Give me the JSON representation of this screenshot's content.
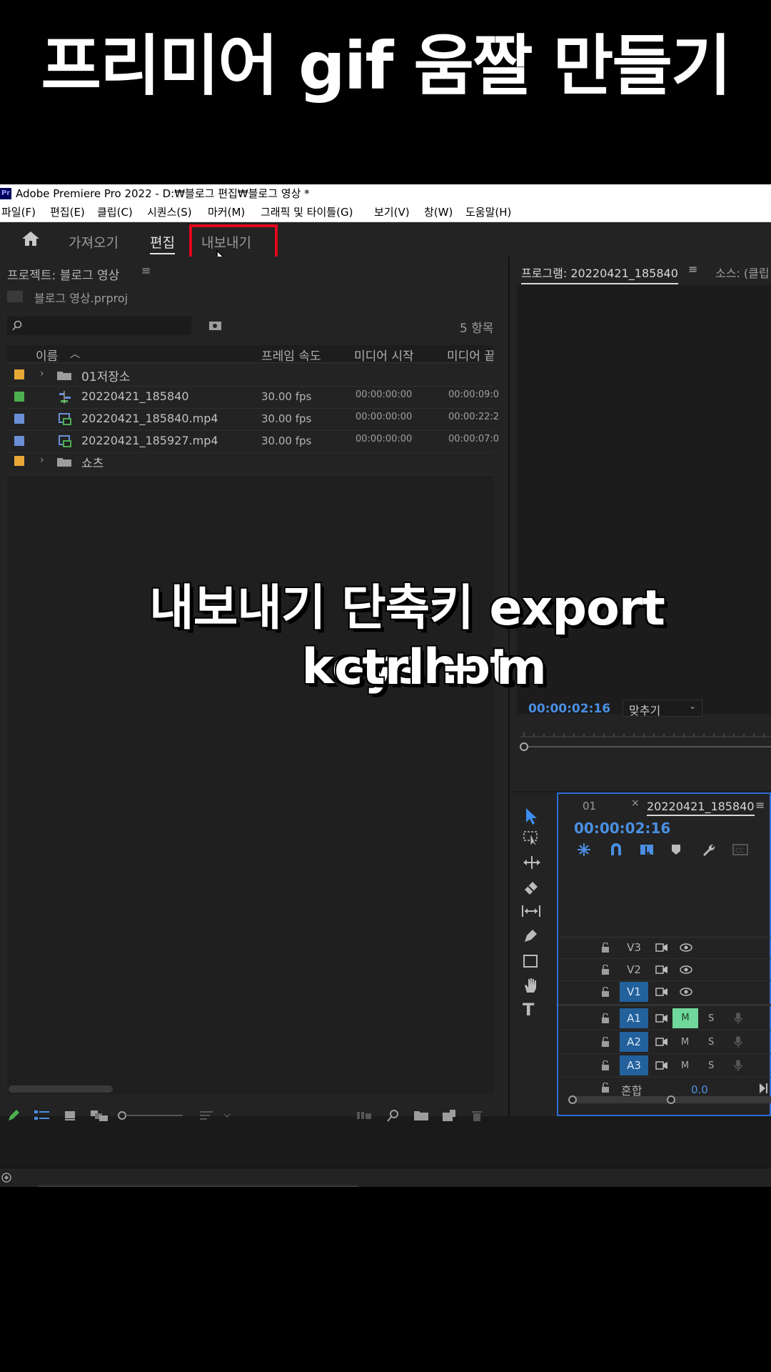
{
  "overlay_title": "프리미어 gif 움짤 만들기",
  "window": {
    "logo": "Pr",
    "title": "Adobe Premiere Pro 2022 - D:₩블로그 편집₩블로그 영상 *"
  },
  "menu": [
    "파일(F)",
    "편집(E)",
    "클립(C)",
    "시퀀스(S)",
    "마커(M)",
    "그래픽 및 타이틀(G)",
    "보기(V)",
    "창(W)",
    "도움말(H)"
  ],
  "workspace_tabs": {
    "import": "가져오기",
    "edit": "편집",
    "export": "내보내기"
  },
  "project_panel": {
    "title": "프로젝트: 블로그 영상",
    "file": "블로그 영상.prproj",
    "item_count": "5 항목",
    "columns": {
      "name": "이름",
      "fps": "프레임 속도",
      "media_start": "미디어 시작",
      "media_end": "미디어 끝"
    },
    "rows": [
      {
        "name": "01저장소",
        "fps": "",
        "start": "",
        "end": "",
        "type": "folder",
        "color": "#e8a838"
      },
      {
        "name": "20220421_185840",
        "fps": "30.00 fps",
        "start": "00:00:00:00",
        "end": "00:00:09:0",
        "type": "sequence",
        "color": "#4caf50"
      },
      {
        "name": "20220421_185840.mp4",
        "fps": "30.00 fps",
        "start": "00:00:00:00",
        "end": "00:00:22:2",
        "type": "clip",
        "color": "#6b8fd6"
      },
      {
        "name": "20220421_185927.mp4",
        "fps": "30.00 fps",
        "start": "00:00:00:00",
        "end": "00:00:07:0",
        "type": "clip",
        "color": "#6b8fd6"
      },
      {
        "name": "쇼츠",
        "fps": "",
        "start": "",
        "end": "",
        "type": "folder",
        "color": "#e8a838"
      }
    ]
  },
  "program_monitor": {
    "tab_program": "프로그램: 20220421_185840",
    "tab_source": "소스: (클립",
    "timecode": "00:00:02:16",
    "fit": "맞추기"
  },
  "overlay_caption": {
    "line1": "내보내기 단축키 export keyshot",
    "line2": "ctrl + m"
  },
  "timeline": {
    "tab_01": "01",
    "tab_seq": "20220421_185840",
    "timecode": "00:00:02:16",
    "tracks": [
      {
        "label": "V3",
        "on": false
      },
      {
        "label": "V2",
        "on": false
      },
      {
        "label": "V1",
        "on": true
      },
      {
        "label": "A1",
        "on": true,
        "m": "M",
        "s": "S",
        "m_active": true
      },
      {
        "label": "A2",
        "on": true,
        "m": "M",
        "s": "S",
        "m_active": false
      },
      {
        "label": "A3",
        "on": true,
        "m": "M",
        "s": "S",
        "m_active": false
      }
    ],
    "mix_label": "혼합",
    "mix_value": "0.0"
  },
  "tools": [
    "select",
    "track-select",
    "ripple",
    "razor",
    "slip",
    "pen",
    "rectangle",
    "hand",
    "type"
  ]
}
